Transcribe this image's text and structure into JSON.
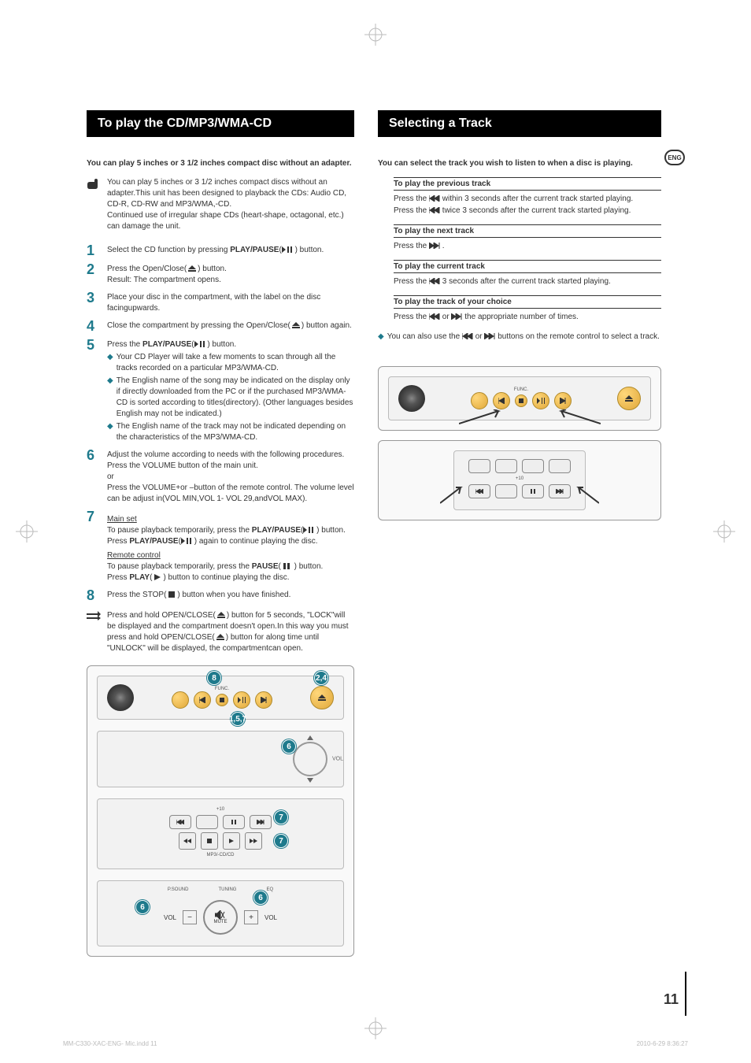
{
  "left": {
    "title": "To play the CD/MP3/WMA-CD",
    "intro": "You can play 5 inches or 3 1/2 inches compact disc without an adapter.",
    "note1_a": "You can play 5 inches or 3 1/2 inches compact discs without an adapter.This unit has been designed to playback the CDs: Audio CD, CD-R, CD-RW and MP3/WMA,-CD.",
    "note1_b": "Continued use of irregular shape CDs (heart-shape, octagonal, etc.) can damage the unit.",
    "steps": {
      "s1_a": "Select the CD function by pressing ",
      "s1_b": "PLAY/PAUSE",
      "s1_c": "(",
      "s1_d": " ) button.",
      "s2_a": "Press the Open/Close(",
      "s2_b": ") button.",
      "s2_c": "Result: The compartment opens.",
      "s3": "Place your disc in the compartment, with the label on the disc facingupwards.",
      "s4_a": "Close the compartment by pressing the Open/Close(",
      "s4_b": ") button again.",
      "s5_a": "Press the ",
      "s5_b": "PLAY/PAUSE",
      "s5_c": "(",
      "s5_d": " ) button.",
      "s5_sub1": "Your CD Player will take a few moments to scan through all the tracks recorded on a particular MP3/WMA-CD.",
      "s5_sub2": "The English name of the song may be indicated on the display only if directly downloaded from the PC or if the purchased MP3/WMA-CD is sorted according to titles(directory). (Other languages besides English may not be indicated.)",
      "s5_sub3": "The English name of the track may not be indicated depending on the characteristics of the MP3/WMA-CD.",
      "s6_a": "Adjust the volume according to needs with the following procedures. Press the VOLUME button of the main unit.",
      "s6_b": "or",
      "s6_c": "Press the VOLUME+or –button of the remote control. The volume level can be adjust in(VOL MIN,VOL 1- VOL 29,andVOL MAX).",
      "s7_main": "Main set",
      "s7_main_a": "To pause playback temporarily, press the ",
      "s7_main_b": "PLAY/PAUSE",
      "s7_main_c": "(",
      "s7_main_d": " ) button.",
      "s7_main_e": "Press ",
      "s7_main_f": "PLAY/PAUSE",
      "s7_main_g": "(",
      "s7_main_h": " ) again to continue playing the disc.",
      "s7_remote": "Remote control",
      "s7_remote_a": "To pause playback temporarily, press the ",
      "s7_remote_b": "PAUSE",
      "s7_remote_c": "(",
      "s7_remote_d": " ) button.",
      "s7_remote_e": "Press ",
      "s7_remote_f": "PLAY",
      "s7_remote_g": "(",
      "s7_remote_h": ") button to continue playing the disc.",
      "s8_a": "Press the STOP(",
      "s8_b": ") button when you have finished."
    },
    "lock_a": "Press and hold OPEN/CLOSE(",
    "lock_b": ") button for 5 seconds, \"LOCK\"will be displayed and the compartment doesn't open.In this way you must press and hold OPEN/CLOSE(",
    "lock_c": ") button for along time until \"UNLOCK\" will be displayed, the compartmentcan open.",
    "markers": {
      "m8": "8",
      "m24": "2,4",
      "m157": "1,5,7",
      "m6a": "6",
      "m7a": "7",
      "m7b": "7",
      "m6b": "6",
      "m6c": "6"
    },
    "panel": {
      "func": "FUNC.",
      "vol": "VOL",
      "plus10": "+10",
      "mp3": "MP3/-CD/CD",
      "tuning": "TUNING",
      "psound": "P.SOUND",
      "eq": "EQ",
      "mute": "MUTE",
      "vol_l": "VOL",
      "minus": "−",
      "plus": "+"
    }
  },
  "right": {
    "title": "Selecting a Track",
    "intro": "You can select the track you wish to listen to when a disc is playing.",
    "sec1_h": "To play the previous track",
    "sec1_a": "Press the ",
    "sec1_b": " within 3 seconds after the current track started playing.",
    "sec1_c": "Press the ",
    "sec1_d": " twice 3 seconds after the current track started playing.",
    "sec2_h": "To play the next track",
    "sec2_a": "Press the ",
    "sec2_b": " .",
    "sec3_h": "To play the current track",
    "sec3_a": "Press the ",
    "sec3_b": " 3 seconds after the current track started playing.",
    "sec4_h": "To play the track of your choice",
    "sec4_a": "Press the ",
    "sec4_b": " or ",
    "sec4_c": " the appropriate number of times.",
    "note_a": "You can also use the ",
    "note_b": " or ",
    "note_c": " buttons on the remote control to select a track.",
    "panel": {
      "func": "FUNC.",
      "plus10": "+10"
    }
  },
  "badge": "ENG",
  "page_num": "11",
  "footer_left": "MM-C330-XAC-ENG- Mic.indd   11",
  "footer_right": "2010-6-29   8:36:27"
}
